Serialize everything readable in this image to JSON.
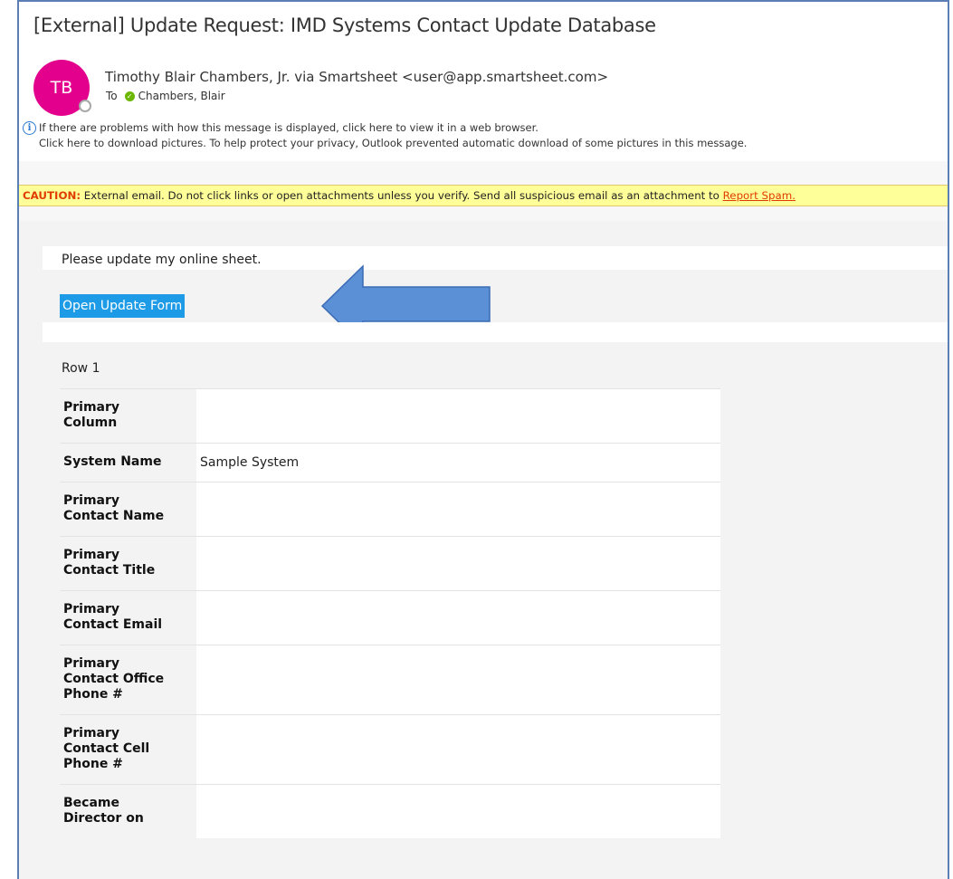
{
  "email": {
    "subject": "[External] Update Request: IMD Systems Contact Update Database",
    "avatar_initials": "TB",
    "avatar_color": "#e3008c",
    "sender": "Timothy Blair Chambers, Jr. via Smartsheet <user@app.smartsheet.com>",
    "to_label": "To",
    "to_recipient": "Chambers, Blair",
    "info_line1": "If there are problems with how this message is displayed, click here to view it in a web browser.",
    "info_line2": "Click here to download pictures. To help protect your privacy, Outlook prevented automatic download of some pictures in this message."
  },
  "caution": {
    "prefix": "CAUTION:",
    "text": " External email. Do not click links or open attachments unless you verify. Send all suspicious email as an attachment to ",
    "link": "Report Spam."
  },
  "body": {
    "message": "Please update my online sheet.",
    "button_label": "Open Update Form",
    "row_label": "Row 1",
    "rows": [
      {
        "label": "Primary Column",
        "value": ""
      },
      {
        "label": "System Name",
        "value": "Sample System"
      },
      {
        "label": "Primary Contact Name",
        "value": ""
      },
      {
        "label": "Primary Contact Title",
        "value": ""
      },
      {
        "label": "Primary Contact Email",
        "value": ""
      },
      {
        "label": "Primary Contact Office Phone #",
        "value": ""
      },
      {
        "label": "Primary Contact Cell Phone #",
        "value": ""
      },
      {
        "label": "Became Director on",
        "value": ""
      }
    ]
  },
  "colors": {
    "button": "#1e9be6",
    "caution_bg": "#ffff99",
    "caution_text": "#e03c00",
    "arrow": "#5b8fd6"
  }
}
